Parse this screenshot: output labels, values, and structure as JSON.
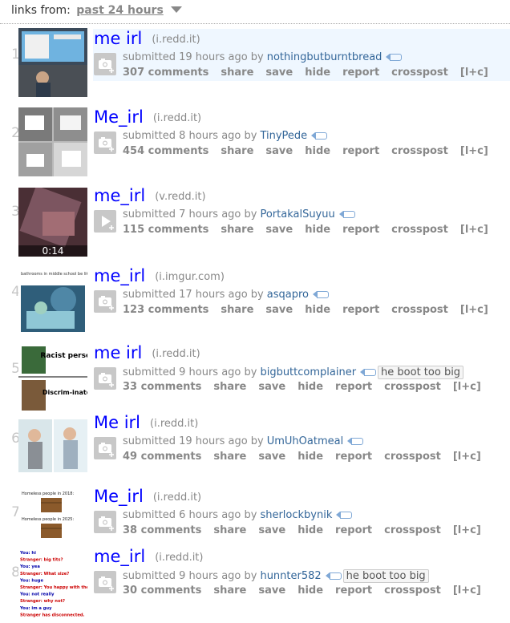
{
  "header": {
    "label": "links from:",
    "selected": "past 24 hours"
  },
  "colors": {
    "title": "#0000ff",
    "author": "#336699",
    "meta": "#888888",
    "highlight": "#eff7ff"
  },
  "posts": [
    {
      "rank": "1",
      "title": "me irl",
      "domain": "(i.redd.it)",
      "submitted": "submitted 19 hours ago by",
      "author": "nothingbutburntbread",
      "flair": "",
      "comments": "307 comments",
      "expando": "image"
    },
    {
      "rank": "2",
      "title": "Me_irl",
      "domain": "(i.redd.it)",
      "submitted": "submitted 8 hours ago by",
      "author": "TinyPede",
      "flair": "",
      "comments": "454 comments",
      "expando": "image"
    },
    {
      "rank": "3",
      "title": "me_irl",
      "domain": "(v.redd.it)",
      "submitted": "submitted 7 hours ago by",
      "author": "PortakalSuyuu",
      "flair": "",
      "comments": "115 comments",
      "expando": "video",
      "duration": "0:14"
    },
    {
      "rank": "4",
      "title": "me_irl",
      "domain": "(i.imgur.com)",
      "submitted": "submitted 17 hours ago by",
      "author": "asqapro",
      "flair": "",
      "comments": "123 comments",
      "expando": "image",
      "thumb_caption": "bathrooms in middle school be like"
    },
    {
      "rank": "5",
      "title": "me irl",
      "domain": "(i.redd.it)",
      "submitted": "submitted 9 hours ago by",
      "author": "bigbuttcomplainer",
      "flair": "he boot too big",
      "comments": "33 comments",
      "expando": "image",
      "thumb_text_1": "Racist person",
      "thumb_text_2": "Discrim-inator"
    },
    {
      "rank": "6",
      "title": "Me irl",
      "domain": "(i.redd.it)",
      "submitted": "submitted 19 hours ago by",
      "author": "UmUhOatmeal",
      "flair": "",
      "comments": "49 comments",
      "expando": "image"
    },
    {
      "rank": "7",
      "title": "Me_irl",
      "domain": "(i.redd.it)",
      "submitted": "submitted 6 hours ago by",
      "author": "sherlockbynik",
      "flair": "",
      "comments": "38 comments",
      "expando": "image",
      "thumb_text_1": "Homeless people in 2018:",
      "thumb_text_2": "Homeless people in 2025:"
    },
    {
      "rank": "8",
      "title": "me_irl",
      "domain": "(i.redd.it)",
      "submitted": "submitted 9 hours ago by",
      "author": "hunnter582",
      "flair": "he boot too big",
      "comments": "30 comments",
      "expando": "image",
      "thumb_chat": [
        "You: hi",
        "Stranger: big tits?",
        "You: yea",
        "Stranger: What size?",
        "You: huge",
        "Stranger: You happy with them?",
        "You: not really",
        "Stranger: why not?",
        "You: im a guy",
        "Stranger has disconnected."
      ]
    }
  ],
  "actions": {
    "share": "share",
    "save": "save",
    "hide": "hide",
    "report": "report",
    "crosspost": "crosspost",
    "lc": "[l+c]"
  }
}
